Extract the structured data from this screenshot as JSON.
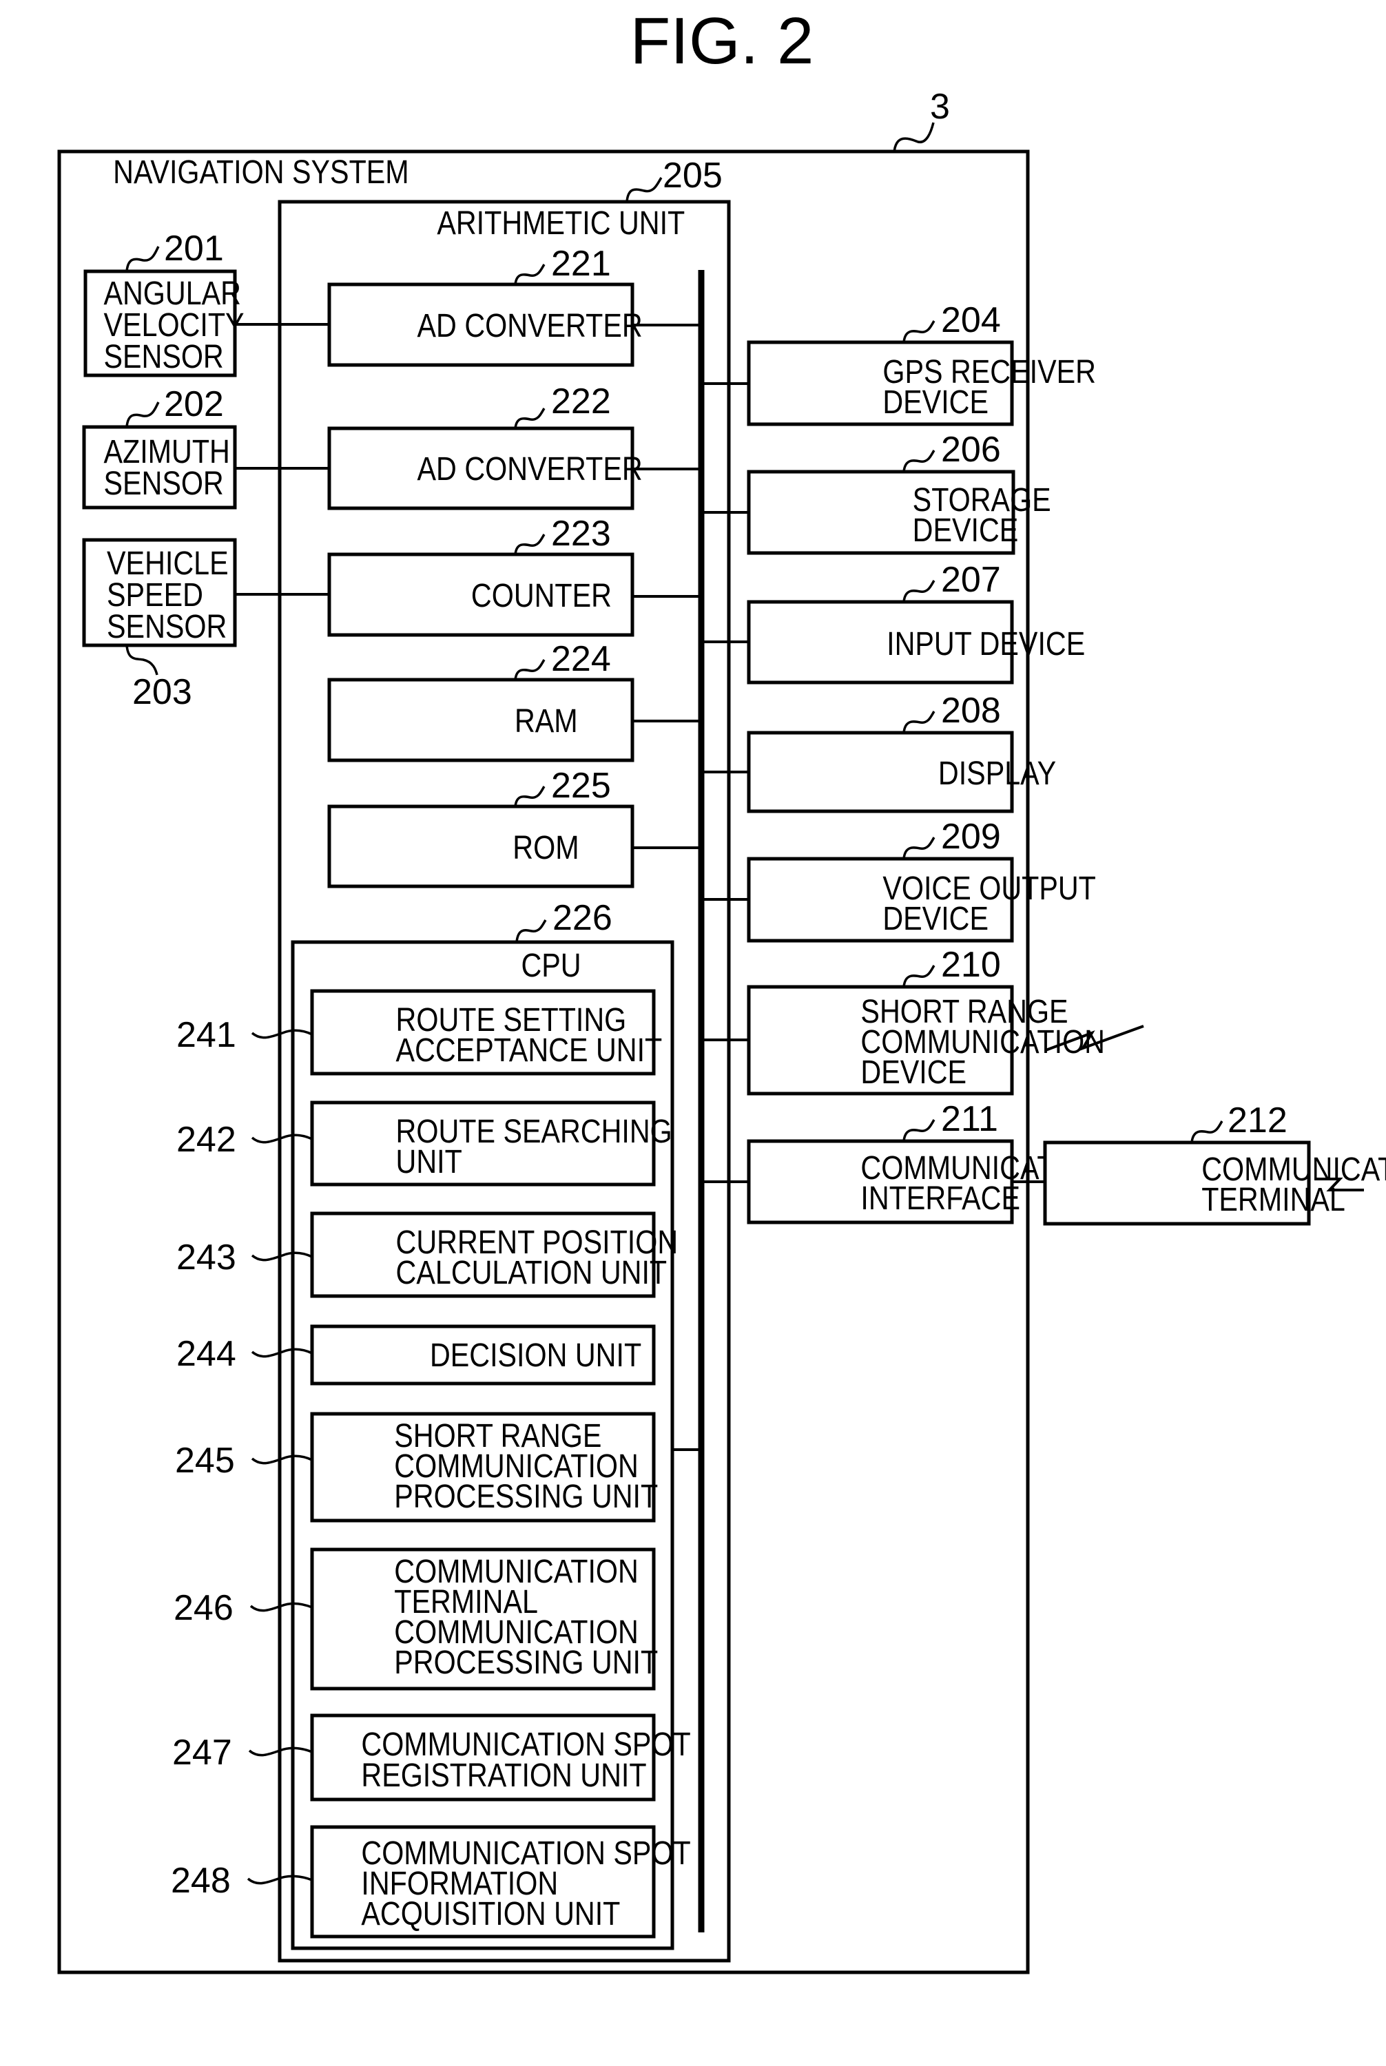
{
  "figure_title": "FIG. 2",
  "system": {
    "ref": "3",
    "label": "NAVIGATION SYSTEM"
  },
  "arithmetic_unit": {
    "ref": "205",
    "label": "ARITHMETIC UNIT"
  },
  "sensors": [
    {
      "ref": "201",
      "lines": [
        "ANGULAR",
        "VELOCITY",
        "SENSOR"
      ]
    },
    {
      "ref": "202",
      "lines": [
        "AZIMUTH",
        "SENSOR"
      ]
    },
    {
      "ref": "203",
      "lines": [
        "VEHICLE",
        "SPEED",
        "SENSOR"
      ]
    }
  ],
  "internal_units": [
    {
      "ref": "221",
      "label": "AD CONVERTER"
    },
    {
      "ref": "222",
      "label": "AD CONVERTER"
    },
    {
      "ref": "223",
      "label": "COUNTER"
    },
    {
      "ref": "224",
      "label": "RAM"
    },
    {
      "ref": "225",
      "label": "ROM"
    }
  ],
  "cpu": {
    "ref": "226",
    "label": "CPU"
  },
  "cpu_units": [
    {
      "ref": "241",
      "lines": [
        "ROUTE SETTING",
        "ACCEPTANCE UNIT"
      ]
    },
    {
      "ref": "242",
      "lines": [
        "ROUTE SEARCHING",
        "UNIT"
      ]
    },
    {
      "ref": "243",
      "lines": [
        "CURRENT POSITION",
        "CALCULATION UNIT"
      ]
    },
    {
      "ref": "244",
      "lines": [
        "DECISION UNIT"
      ]
    },
    {
      "ref": "245",
      "lines": [
        "SHORT RANGE",
        "COMMUNICATION",
        "PROCESSING UNIT"
      ]
    },
    {
      "ref": "246",
      "lines": [
        "COMMUNICATION",
        "TERMINAL",
        "COMMUNICATION",
        "PROCESSING UNIT"
      ]
    },
    {
      "ref": "247",
      "lines": [
        "COMMUNICATION SPOT",
        "REGISTRATION UNIT"
      ]
    },
    {
      "ref": "248",
      "lines": [
        "COMMUNICATION SPOT",
        "INFORMATION",
        "ACQUISITION UNIT"
      ]
    }
  ],
  "devices": [
    {
      "ref": "204",
      "lines": [
        "GPS RECEIVER",
        "DEVICE"
      ]
    },
    {
      "ref": "206",
      "lines": [
        "STORAGE",
        "DEVICE"
      ]
    },
    {
      "ref": "207",
      "lines": [
        "INPUT DEVICE"
      ]
    },
    {
      "ref": "208",
      "lines": [
        "DISPLAY"
      ]
    },
    {
      "ref": "209",
      "lines": [
        "VOICE OUTPUT",
        "DEVICE"
      ]
    },
    {
      "ref": "210",
      "lines": [
        "SHORT RANGE",
        "COMMUNICATION",
        "DEVICE"
      ]
    },
    {
      "ref": "211",
      "lines": [
        "COMMUNICATION",
        "INTERFACE"
      ]
    }
  ],
  "external": {
    "ref": "212",
    "lines": [
      "COMMUNICATION",
      "TERMINAL"
    ]
  }
}
